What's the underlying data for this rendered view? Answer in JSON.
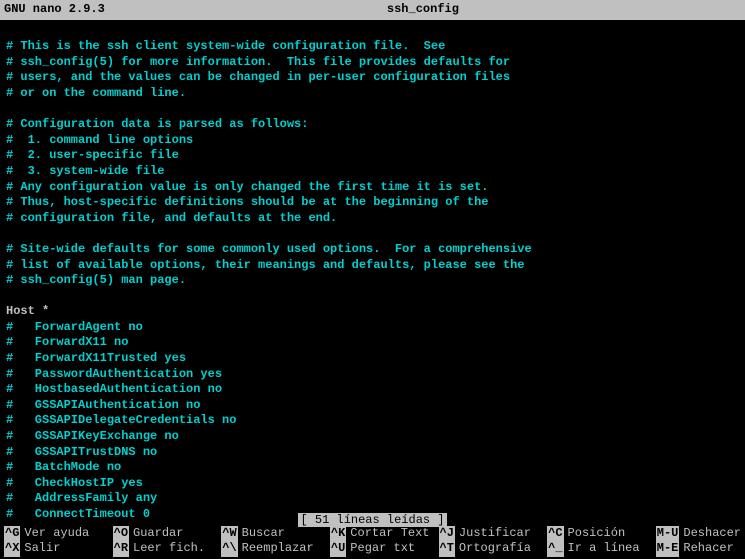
{
  "titlebar": {
    "app": "GNU nano 2.9.3",
    "filename": "ssh_config"
  },
  "content_lines": [
    "",
    "# This is the ssh client system-wide configuration file.  See",
    "# ssh_config(5) for more information.  This file provides defaults for",
    "# users, and the values can be changed in per-user configuration files",
    "# or on the command line.",
    "",
    "# Configuration data is parsed as follows:",
    "#  1. command line options",
    "#  2. user-specific file",
    "#  3. system-wide file",
    "# Any configuration value is only changed the first time it is set.",
    "# Thus, host-specific definitions should be at the beginning of the",
    "# configuration file, and defaults at the end.",
    "",
    "# Site-wide defaults for some commonly used options.  For a comprehensive",
    "# list of available options, their meanings and defaults, please see the",
    "# ssh_config(5) man page.",
    ""
  ],
  "host_line": "Host *",
  "commented_options": [
    "#   ForwardAgent no",
    "#   ForwardX11 no",
    "#   ForwardX11Trusted yes",
    "#   PasswordAuthentication yes",
    "#   HostbasedAuthentication no",
    "#   GSSAPIAuthentication no",
    "#   GSSAPIDelegateCredentials no",
    "#   GSSAPIKeyExchange no",
    "#   GSSAPITrustDNS no",
    "#   BatchMode no",
    "#   CheckHostIP yes",
    "#   AddressFamily any",
    "#   ConnectTimeout 0"
  ],
  "status": "[ 51 líneas leídas ]",
  "shortcuts": [
    {
      "key": "^G",
      "label": "Ver ayuda"
    },
    {
      "key": "^X",
      "label": "Salir"
    },
    {
      "key": "^O",
      "label": "Guardar"
    },
    {
      "key": "^R",
      "label": "Leer fich."
    },
    {
      "key": "^W",
      "label": "Buscar"
    },
    {
      "key": "^\\",
      "label": "Reemplazar"
    },
    {
      "key": "^K",
      "label": "Cortar Text"
    },
    {
      "key": "^U",
      "label": "Pegar txt"
    },
    {
      "key": "^J",
      "label": "Justificar"
    },
    {
      "key": "^T",
      "label": "Ortografía"
    },
    {
      "key": "^C",
      "label": "Posición"
    },
    {
      "key": "^_",
      "label": "Ir a línea"
    },
    {
      "key": "M-U",
      "label": "Deshacer"
    },
    {
      "key": "M-E",
      "label": "Rehacer"
    }
  ]
}
